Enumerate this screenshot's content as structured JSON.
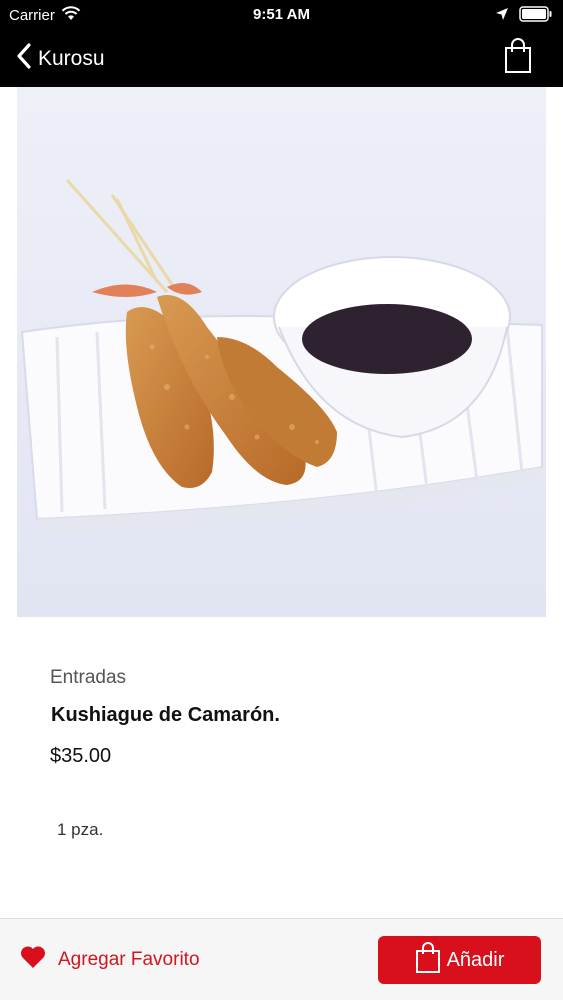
{
  "status_bar": {
    "carrier": "Carrier",
    "time": "9:51 AM"
  },
  "nav": {
    "back_label": "Kurosu"
  },
  "product": {
    "category": "Entradas",
    "name": "Kushiague de Camarón.",
    "price": "$35.00",
    "description": "1 pza."
  },
  "actions": {
    "favorite_label": "Agregar Favorito",
    "add_label": "Añadir"
  },
  "colors": {
    "accent": "#d8101c",
    "nav_background": "#000000"
  },
  "icons": {
    "back": "chevron-left-icon",
    "cart": "shopping-bag-icon",
    "favorite": "heart-icon",
    "wifi": "wifi-icon",
    "location": "location-arrow-icon",
    "battery": "battery-icon"
  }
}
